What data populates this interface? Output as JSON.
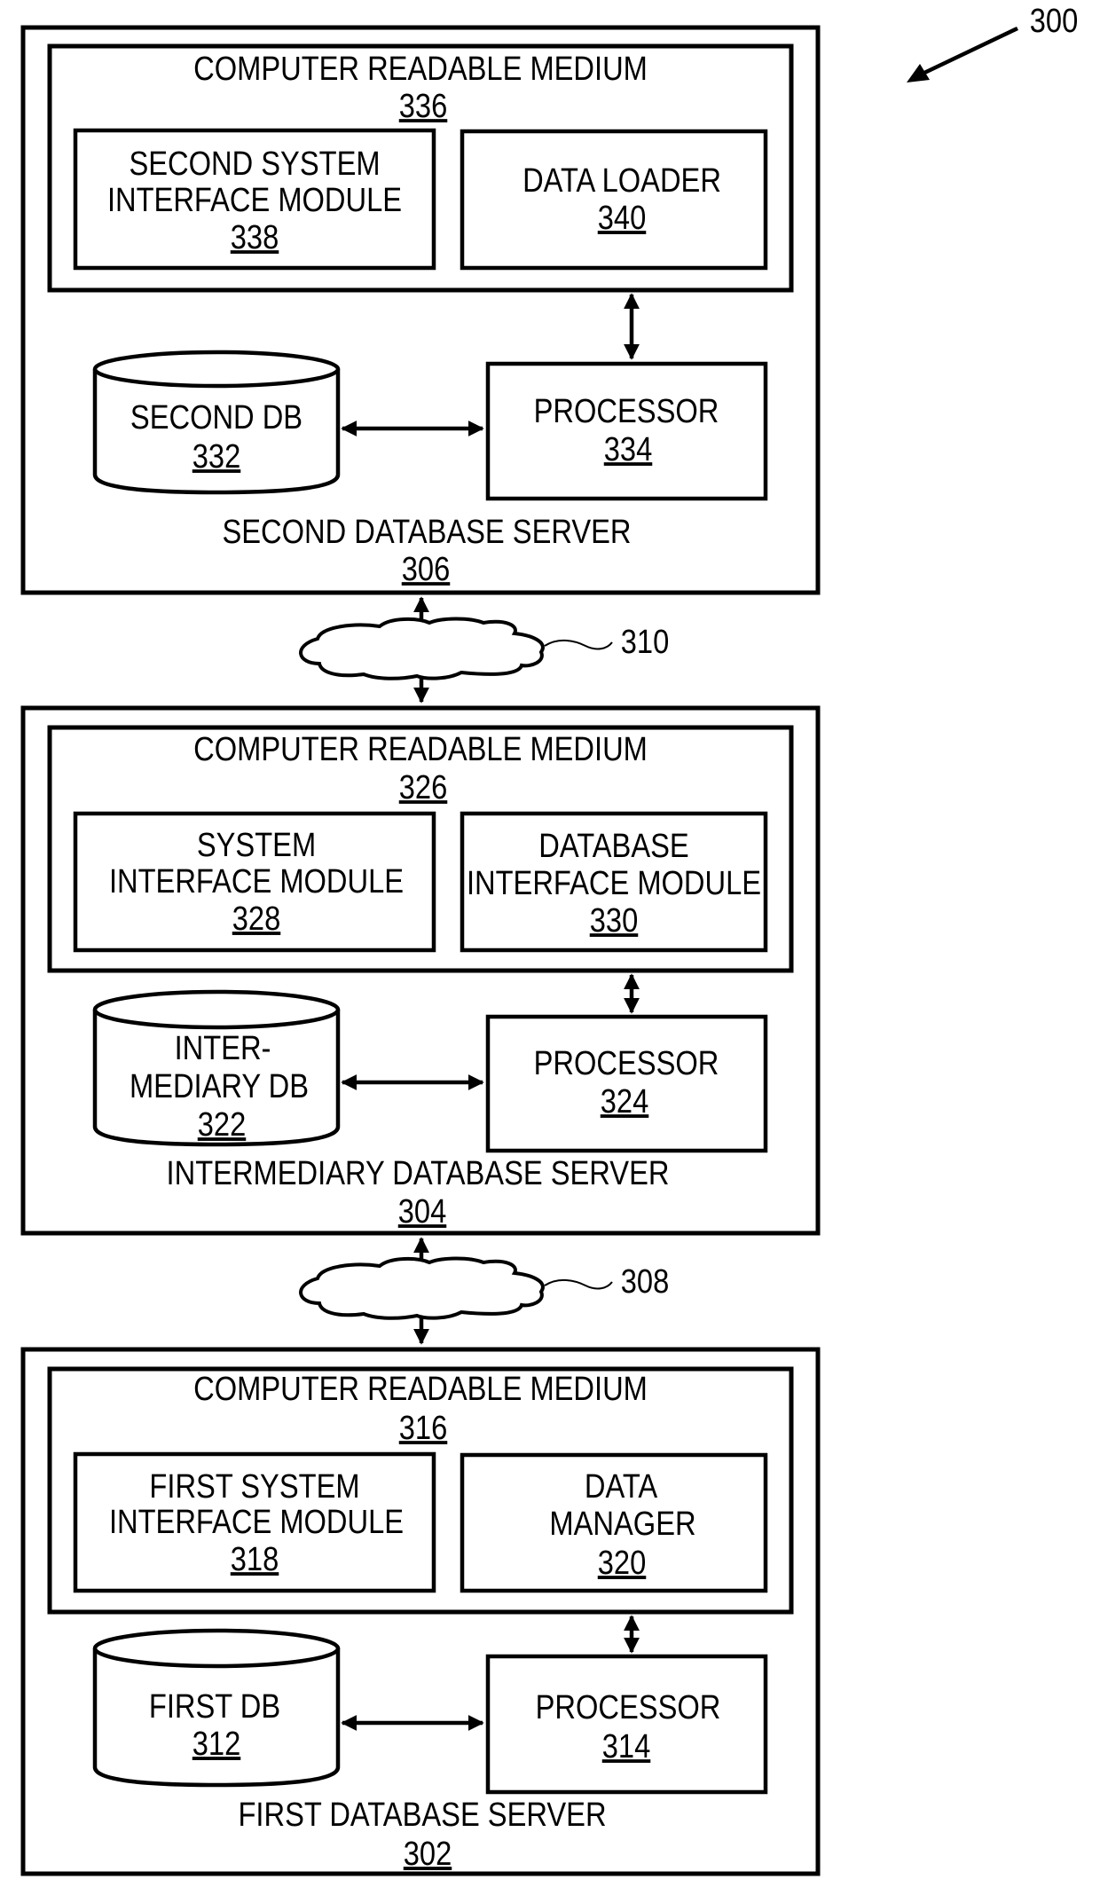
{
  "figure": {
    "ref": "300",
    "colors": {
      "ink": "#000000",
      "background": "#ffffff"
    }
  },
  "servers": [
    {
      "id": "second",
      "name": "SECOND DATABASE SERVER",
      "ref": "306",
      "crm": {
        "title": "COMPUTER READABLE MEDIUM",
        "ref": "336"
      },
      "modules": [
        {
          "lines": [
            "SECOND SYSTEM",
            "INTERFACE MODULE"
          ],
          "ref": "338"
        },
        {
          "lines": [
            "DATA LOADER"
          ],
          "ref": "340"
        }
      ],
      "db": {
        "lines": [
          "SECOND DB"
        ],
        "ref": "332"
      },
      "processor": {
        "label": "PROCESSOR",
        "ref": "334"
      }
    },
    {
      "id": "intermediary",
      "name": "INTERMEDIARY DATABASE SERVER",
      "ref": "304",
      "crm": {
        "title": "COMPUTER READABLE MEDIUM",
        "ref": "326"
      },
      "modules": [
        {
          "lines": [
            "SYSTEM",
            "INTERFACE MODULE"
          ],
          "ref": "328"
        },
        {
          "lines": [
            "DATABASE",
            "INTERFACE MODULE"
          ],
          "ref": "330"
        }
      ],
      "db": {
        "lines": [
          "INTER-",
          "MEDIARY DB"
        ],
        "ref": "322"
      },
      "processor": {
        "label": "PROCESSOR",
        "ref": "324"
      }
    },
    {
      "id": "first",
      "name": "FIRST DATABASE SERVER",
      "ref": "302",
      "crm": {
        "title": "COMPUTER READABLE MEDIUM",
        "ref": "316"
      },
      "modules": [
        {
          "lines": [
            "FIRST SYSTEM",
            "INTERFACE MODULE"
          ],
          "ref": "318"
        },
        {
          "lines": [
            "DATA",
            "MANAGER"
          ],
          "ref": "320"
        }
      ],
      "db": {
        "lines": [
          "FIRST DB"
        ],
        "ref": "312"
      },
      "processor": {
        "label": "PROCESSOR",
        "ref": "314"
      }
    }
  ],
  "networks": [
    {
      "id": "network-310",
      "ref": "310"
    },
    {
      "id": "network-308",
      "ref": "308"
    }
  ]
}
